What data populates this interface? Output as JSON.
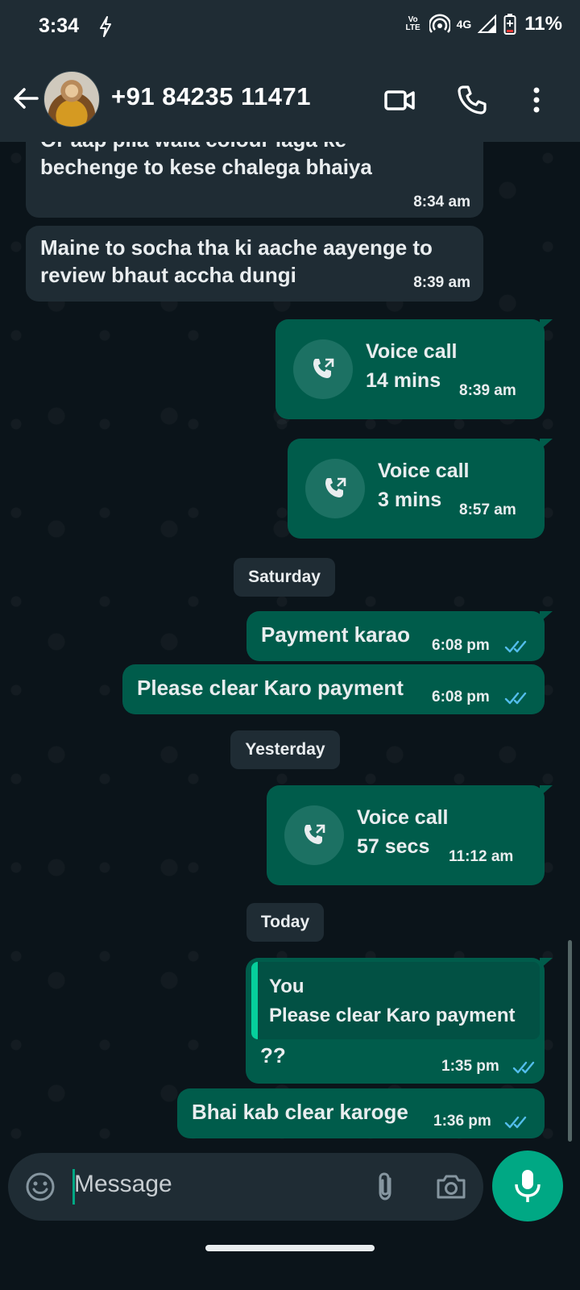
{
  "status_bar": {
    "time": "3:34",
    "volte_top": "Vo",
    "volte_bottom": "LTE",
    "network": "4G",
    "battery": "11%"
  },
  "header": {
    "contact": "+91 84235 11471",
    "icons": [
      "back-arrow-icon",
      "avatar",
      "video-call-icon",
      "phone-icon",
      "more-options-icon"
    ]
  },
  "messages": [
    {
      "type": "in",
      "lines": [
        "Or aap pila wala colour laga ke",
        "bechenge to kese chalega bhaiya"
      ],
      "time": "8:34 am"
    },
    {
      "type": "in",
      "lines": [
        "Maine to socha tha ki aache aayenge to",
        "review bhaut  accha dungi"
      ],
      "time": "8:39 am"
    },
    {
      "type": "call",
      "title": "Voice call",
      "duration": "14 mins",
      "time": "8:39 am"
    },
    {
      "type": "call",
      "title": "Voice call",
      "duration": "3 mins",
      "time": "8:57 am"
    },
    {
      "type": "date",
      "label": "Saturday"
    },
    {
      "type": "out",
      "text": "Payment karao",
      "time": "6:08 pm"
    },
    {
      "type": "out",
      "text": "Please clear Karo payment",
      "time": "6:08 pm"
    },
    {
      "type": "date",
      "label": "Yesterday"
    },
    {
      "type": "call",
      "title": "Voice call",
      "duration": "57 secs",
      "time": "11:12 am"
    },
    {
      "type": "date",
      "label": "Today"
    },
    {
      "type": "reply",
      "quote_author": "You",
      "quote_text": "Please clear Karo payment",
      "text": "??",
      "time": "1:35 pm"
    },
    {
      "type": "out",
      "text": "Bhai kab clear karoge",
      "time": "1:36 pm"
    }
  ],
  "composer": {
    "placeholder": "Message",
    "icons": [
      "emoji-icon",
      "attach-icon",
      "camera-icon",
      "mic-icon"
    ]
  },
  "colors": {
    "background": "#0b141a",
    "bar": "#1f2c34",
    "outgoing": "#005c4b",
    "incoming": "#1f2c34",
    "accent": "#00a884",
    "read_ticks": "#53bdeb"
  }
}
